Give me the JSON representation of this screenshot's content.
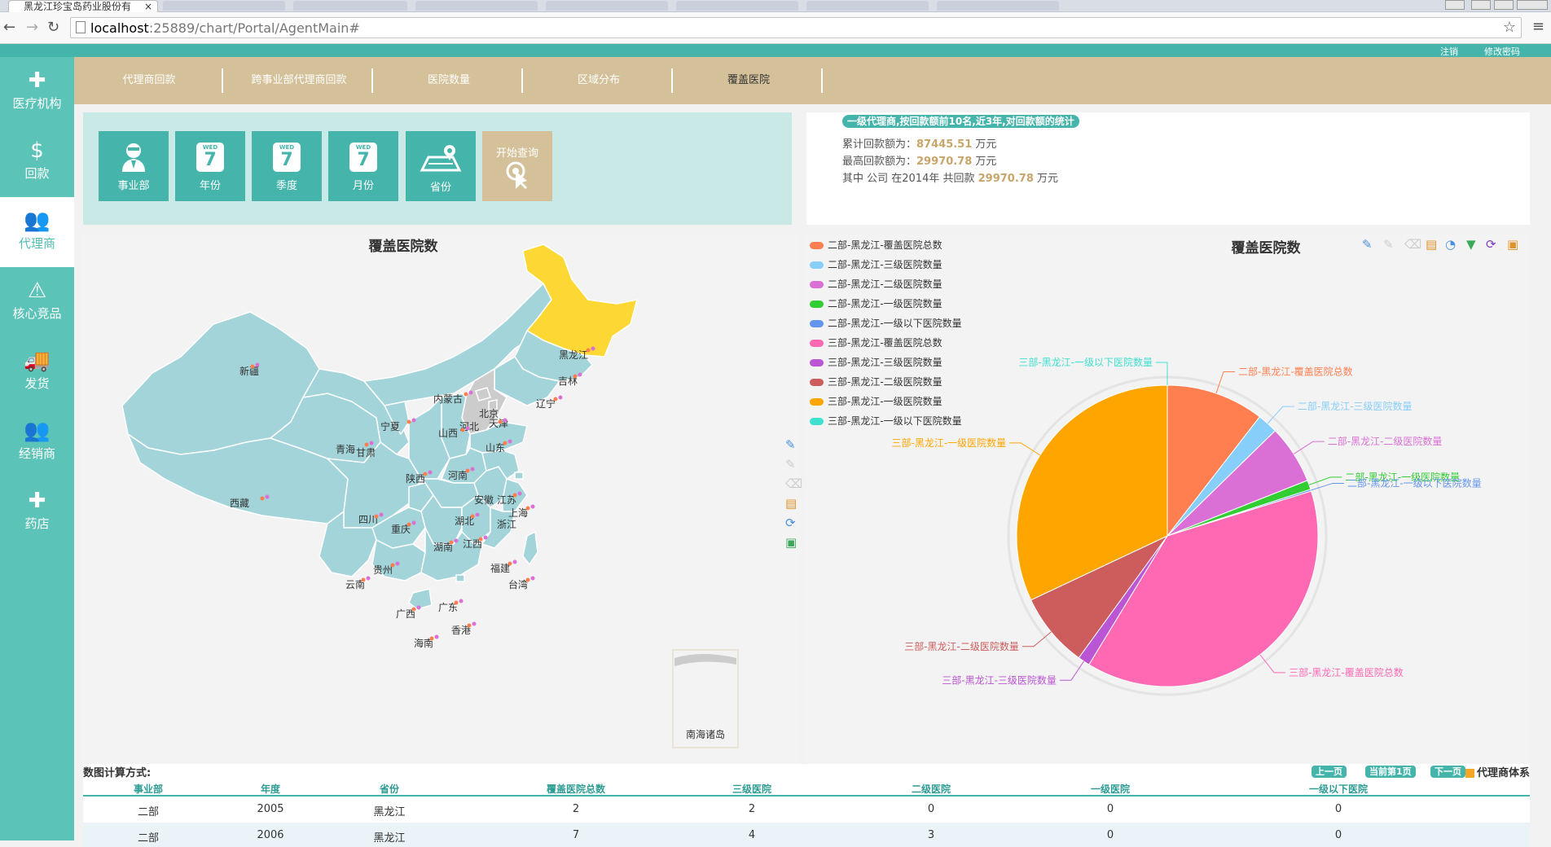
{
  "browser": {
    "tab_title": "黑龙江珍宝岛药业股份有",
    "tab_close": "×",
    "url_host": "localhost",
    "url_rest": ":25889/chart/Portal/AgentMain#"
  },
  "header": {
    "logout": "注销",
    "change_password": "修改密码"
  },
  "sidebar": {
    "items": [
      {
        "label": "医疗机构",
        "icon": "hospital-cross-icon",
        "glyph": "✚"
      },
      {
        "label": "回款",
        "icon": "money-icon",
        "glyph": "$"
      },
      {
        "label": "代理商",
        "icon": "agents-icon",
        "glyph": "👥"
      },
      {
        "label": "核心竞品",
        "icon": "warning-icon",
        "glyph": "⚠"
      },
      {
        "label": "发货",
        "icon": "truck-icon",
        "glyph": "🚚"
      },
      {
        "label": "经销商",
        "icon": "dealers-icon",
        "glyph": "👥"
      },
      {
        "label": "药店",
        "icon": "pharmacy-icon",
        "glyph": "✚"
      }
    ]
  },
  "nav": {
    "tabs": [
      {
        "label": "代理商回款"
      },
      {
        "label": "跨事业部代理商回款"
      },
      {
        "label": "医院数量"
      },
      {
        "label": "区域分布"
      },
      {
        "label": "覆盖医院"
      }
    ]
  },
  "filters": {
    "division": "事业部",
    "year": "年份",
    "quarter": "季度",
    "month": "月份",
    "province": "省份",
    "cal_weekday": "WED",
    "cal_day": "7",
    "query": "开始查询"
  },
  "stats": {
    "badge": "一级代理商,按回款额前10名,近3年,对回款额的统计",
    "total_label": "累计回款额为：",
    "total_value": "87445.51",
    "max_label": "最高回款额为：",
    "max_value": "29970.78",
    "unit": "万元",
    "detail_prefix": "其中 公司 在2014年 共回款",
    "detail_value": "29970.78"
  },
  "map": {
    "title": "覆盖医院数",
    "colors": {
      "land": "#a3d4d9",
      "highlight": "#fdd835",
      "selected": "#cccccc",
      "border": "#ffffff"
    },
    "provinces": [
      "新疆",
      "西藏",
      "青海",
      "甘肃",
      "宁夏",
      "内蒙古",
      "黑龙江",
      "吉林",
      "辽宁",
      "北京",
      "天津",
      "河北",
      "山西",
      "山东",
      "陕西",
      "河南",
      "四川",
      "重庆",
      "湖北",
      "安徽",
      "江苏",
      "上海",
      "浙江",
      "湖南",
      "江西",
      "福建",
      "台湾",
      "贵州",
      "云南",
      "广西",
      "广东",
      "香港",
      "海南"
    ],
    "inset_label": "南海诸岛"
  },
  "chart_data": {
    "type": "pie",
    "title": "覆盖医院数",
    "series": [
      {
        "name": "二部-黑龙江-覆盖医院总数",
        "value": 10.5,
        "color": "#ff7f50"
      },
      {
        "name": "二部-黑龙江-三级医院数量",
        "value": 2.2,
        "color": "#87cefa"
      },
      {
        "name": "二部-黑龙江-二级医院数量",
        "value": 6.3,
        "color": "#da70d6"
      },
      {
        "name": "二部-黑龙江-一级医院数量",
        "value": 1.0,
        "color": "#32cd32"
      },
      {
        "name": "二部-黑龙江-一级以下医院数量",
        "value": 0.2,
        "color": "#6495ed"
      },
      {
        "name": "三部-黑龙江-覆盖医院总数",
        "value": 38.5,
        "color": "#ff69b4"
      },
      {
        "name": "三部-黑龙江-三级医院数量",
        "value": 1.3,
        "color": "#ba55d3"
      },
      {
        "name": "三部-黑龙江-二级医院数量",
        "value": 8.0,
        "color": "#cd5c5c"
      },
      {
        "name": "三部-黑龙江-一级医院数量",
        "value": 32.0,
        "color": "#ffa500"
      },
      {
        "name": "三部-黑龙江-一级以下医院数量",
        "value": 0.0,
        "color": "#40e0d0"
      }
    ]
  },
  "table": {
    "calc_label": "数图计算方式:",
    "prev": "上一页",
    "current": "当前第1页",
    "next": "下一页",
    "agent_system": "代理商体系",
    "columns": [
      "事业部",
      "年度",
      "省份",
      "覆盖医院总数",
      "三级医院",
      "二级医院",
      "一级医院",
      "一级以下医院"
    ],
    "rows": [
      [
        "二部",
        "2005",
        "黑龙江",
        "2",
        "2",
        "0",
        "0",
        "0"
      ],
      [
        "二部",
        "2006",
        "黑龙江",
        "7",
        "4",
        "3",
        "0",
        "0"
      ]
    ]
  }
}
